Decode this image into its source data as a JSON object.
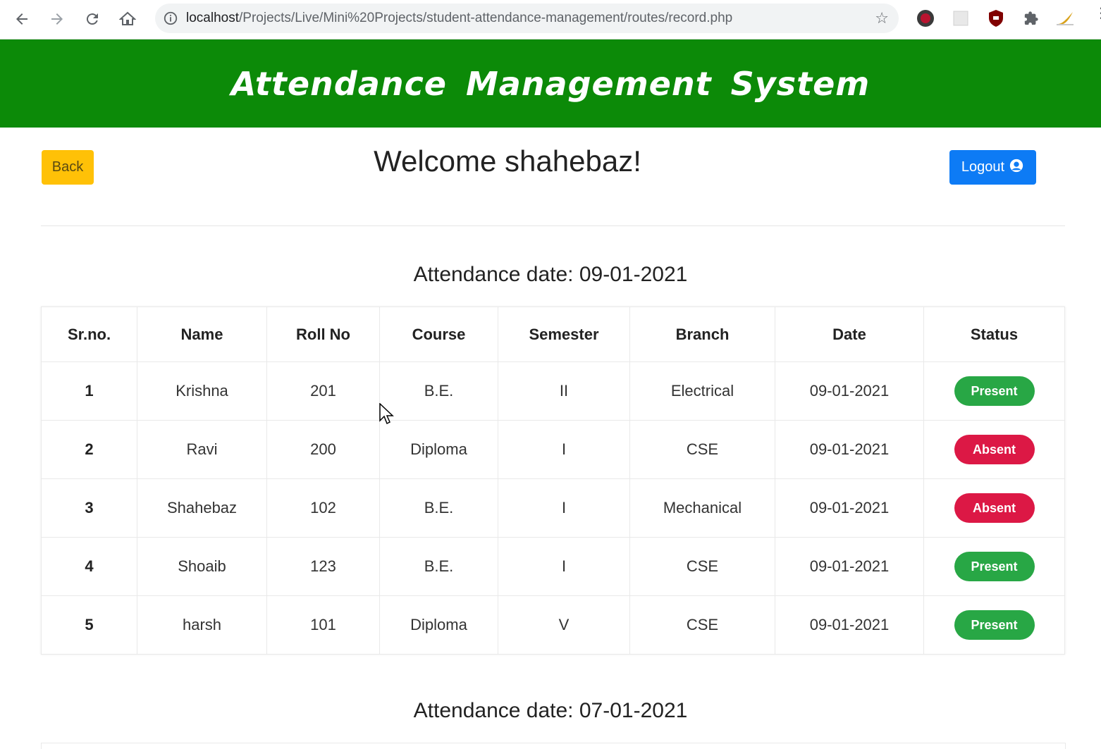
{
  "browser": {
    "url_host": "localhost",
    "url_path": "/Projects/Live/Mini%20Projects/student-attendance-management/routes/record.php",
    "extensions": [
      "k-extension-icon",
      "grid-extension-icon",
      "ublock-icon",
      "puzzle-icon",
      "pen-icon"
    ]
  },
  "header": {
    "title": "Attendance Management System",
    "color": "#0c8a08"
  },
  "toolbar": {
    "back_label": "Back",
    "welcome": "Welcome shahebaz!",
    "logout_label": "Logout"
  },
  "sections": [
    {
      "title": "Attendance date: 09-01-2021",
      "columns": [
        "Sr.no.",
        "Name",
        "Roll No",
        "Course",
        "Semester",
        "Branch",
        "Date",
        "Status"
      ],
      "rows": [
        {
          "sr": "1",
          "name": "Krishna",
          "roll": "201",
          "course": "B.E.",
          "semester": "II",
          "branch": "Electrical",
          "date": "09-01-2021",
          "status": "Present"
        },
        {
          "sr": "2",
          "name": "Ravi",
          "roll": "200",
          "course": "Diploma",
          "semester": "I",
          "branch": "CSE",
          "date": "09-01-2021",
          "status": "Absent"
        },
        {
          "sr": "3",
          "name": "Shahebaz",
          "roll": "102",
          "course": "B.E.",
          "semester": "I",
          "branch": "Mechanical",
          "date": "09-01-2021",
          "status": "Absent"
        },
        {
          "sr": "4",
          "name": "Shoaib",
          "roll": "123",
          "course": "B.E.",
          "semester": "I",
          "branch": "CSE",
          "date": "09-01-2021",
          "status": "Present"
        },
        {
          "sr": "5",
          "name": "harsh",
          "roll": "101",
          "course": "Diploma",
          "semester": "V",
          "branch": "CSE",
          "date": "09-01-2021",
          "status": "Present"
        }
      ]
    },
    {
      "title": "Attendance date: 07-01-2021"
    }
  ],
  "colors": {
    "present": "#28a745",
    "absent": "#dc1845",
    "back": "#ffc107",
    "logout": "#0d7bf5"
  }
}
